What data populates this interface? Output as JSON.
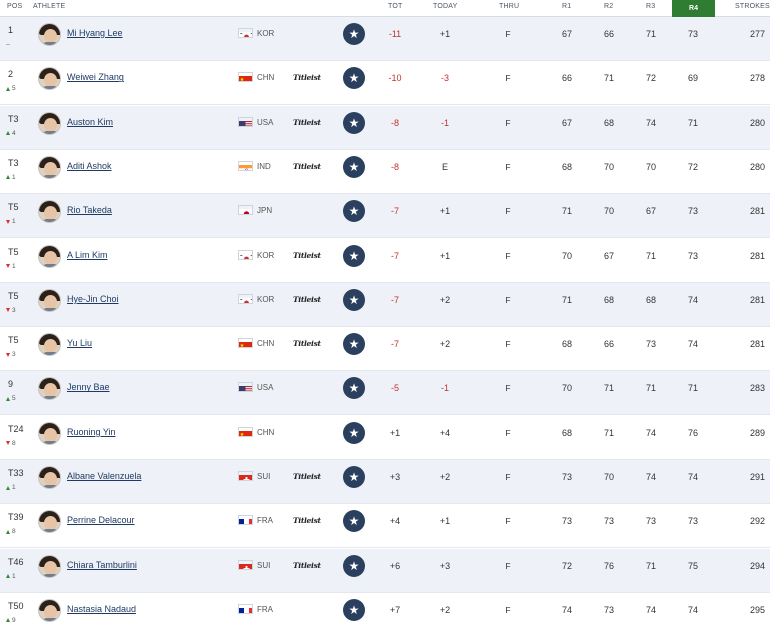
{
  "colors": {
    "accent_green": "#2e7d32",
    "under_par": "#c0312b",
    "row_alt": "#eef2f8",
    "star_button": "#2b3f5e",
    "name_link": "#1f3a63"
  },
  "header": {
    "pos": "POS",
    "athlete": "ATHLETE",
    "tot": "TOT",
    "today": "TODAY",
    "thru": "THRU",
    "r1": "R1",
    "r2": "R2",
    "r3": "R3",
    "r4": "R4",
    "strokes": "STROKES"
  },
  "rows": [
    {
      "pos": "1",
      "move": "–",
      "dir": "none",
      "name": "Mi Hyang Lee",
      "flag": "kor",
      "country": "KOR",
      "sponsor": "",
      "tot": "-11",
      "today": "+1",
      "thru": "F",
      "r1": "67",
      "r2": "66",
      "r3": "71",
      "r4": "73",
      "strokes": "277"
    },
    {
      "pos": "2",
      "move": "5",
      "dir": "up",
      "name": "Weiwei Zhang",
      "flag": "chn",
      "country": "CHN",
      "sponsor": "Titleist",
      "tot": "-10",
      "today": "-3",
      "thru": "F",
      "r1": "66",
      "r2": "71",
      "r3": "72",
      "r4": "69",
      "strokes": "278"
    },
    {
      "pos": "T3",
      "move": "4",
      "dir": "up",
      "name": "Auston Kim",
      "flag": "usa",
      "country": "USA",
      "sponsor": "Titleist",
      "tot": "-8",
      "today": "-1",
      "thru": "F",
      "r1": "67",
      "r2": "68",
      "r3": "74",
      "r4": "71",
      "strokes": "280"
    },
    {
      "pos": "T3",
      "move": "1",
      "dir": "up",
      "name": "Aditi Ashok",
      "flag": "ind",
      "country": "IND",
      "sponsor": "Titleist",
      "tot": "-8",
      "today": "E",
      "thru": "F",
      "r1": "68",
      "r2": "70",
      "r3": "70",
      "r4": "72",
      "strokes": "280"
    },
    {
      "pos": "T5",
      "move": "1",
      "dir": "down",
      "name": "Rio Takeda",
      "flag": "jpn",
      "country": "JPN",
      "sponsor": "",
      "tot": "-7",
      "today": "+1",
      "thru": "F",
      "r1": "71",
      "r2": "70",
      "r3": "67",
      "r4": "73",
      "strokes": "281"
    },
    {
      "pos": "T5",
      "move": "1",
      "dir": "down",
      "name": "A Lim Kim",
      "flag": "kor",
      "country": "KOR",
      "sponsor": "Titleist",
      "tot": "-7",
      "today": "+1",
      "thru": "F",
      "r1": "70",
      "r2": "67",
      "r3": "71",
      "r4": "73",
      "strokes": "281"
    },
    {
      "pos": "T5",
      "move": "3",
      "dir": "down",
      "name": "Hye-Jin Choi",
      "flag": "kor",
      "country": "KOR",
      "sponsor": "Titleist",
      "tot": "-7",
      "today": "+2",
      "thru": "F",
      "r1": "71",
      "r2": "68",
      "r3": "68",
      "r4": "74",
      "strokes": "281"
    },
    {
      "pos": "T5",
      "move": "3",
      "dir": "down",
      "name": "Yu Liu",
      "flag": "chn",
      "country": "CHN",
      "sponsor": "Titleist",
      "tot": "-7",
      "today": "+2",
      "thru": "F",
      "r1": "68",
      "r2": "66",
      "r3": "73",
      "r4": "74",
      "strokes": "281"
    },
    {
      "pos": "9",
      "move": "5",
      "dir": "up",
      "name": "Jenny Bae",
      "flag": "usa",
      "country": "USA",
      "sponsor": "",
      "tot": "-5",
      "today": "-1",
      "thru": "F",
      "r1": "70",
      "r2": "71",
      "r3": "71",
      "r4": "71",
      "strokes": "283"
    },
    {
      "pos": "T24",
      "move": "8",
      "dir": "down",
      "name": "Ruoning Yin",
      "flag": "chn",
      "country": "CHN",
      "sponsor": "",
      "tot": "+1",
      "today": "+4",
      "thru": "F",
      "r1": "68",
      "r2": "71",
      "r3": "74",
      "r4": "76",
      "strokes": "289"
    },
    {
      "pos": "T33",
      "move": "1",
      "dir": "up",
      "name": "Albane Valenzuela",
      "flag": "sui",
      "country": "SUI",
      "sponsor": "Titleist",
      "tot": "+3",
      "today": "+2",
      "thru": "F",
      "r1": "73",
      "r2": "70",
      "r3": "74",
      "r4": "74",
      "strokes": "291"
    },
    {
      "pos": "T39",
      "move": "8",
      "dir": "up",
      "name": "Perrine Delacour",
      "flag": "fra",
      "country": "FRA",
      "sponsor": "Titleist",
      "tot": "+4",
      "today": "+1",
      "thru": "F",
      "r1": "73",
      "r2": "73",
      "r3": "73",
      "r4": "73",
      "strokes": "292"
    },
    {
      "pos": "T46",
      "move": "1",
      "dir": "up",
      "name": "Chiara Tamburlini",
      "flag": "sui",
      "country": "SUI",
      "sponsor": "Titleist",
      "tot": "+6",
      "today": "+3",
      "thru": "F",
      "r1": "72",
      "r2": "76",
      "r3": "71",
      "r4": "75",
      "strokes": "294"
    },
    {
      "pos": "T50",
      "move": "9",
      "dir": "up",
      "name": "Nastasia Nadaud",
      "flag": "fra",
      "country": "FRA",
      "sponsor": "",
      "tot": "+7",
      "today": "+2",
      "thru": "F",
      "r1": "74",
      "r2": "73",
      "r3": "74",
      "r4": "74",
      "strokes": "295"
    }
  ]
}
